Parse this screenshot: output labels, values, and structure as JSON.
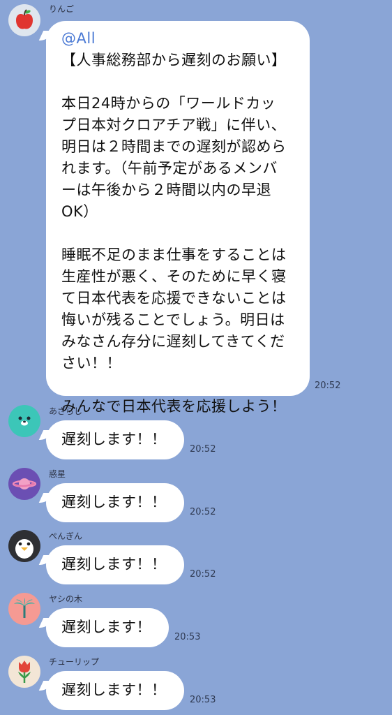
{
  "messages": [
    {
      "sender": "りんご",
      "avatar_icon": "apple-icon",
      "mention": "@All",
      "lines": [
        "【人事総務部から遅刻のお願い】",
        "",
        "本日24時からの「ワールドカッ",
        "プ日本対クロアチア戦」に伴い、",
        "明日は２時間までの遅刻が認めら",
        "れます。（午前予定があるメンバ",
        "ーは午後から２時間以内の早退",
        "OK）",
        "",
        "睡眠不足のまま仕事をすることは",
        "生産性が悪く、そのために早く寝",
        "て日本代表を応援できないことは",
        "悔いが残ることでしょう。明日は",
        "みなさん存分に遅刻してきてくだ",
        "さい！！",
        "",
        "みんなで日本代表を応援しよう！"
      ],
      "time": "20:52"
    },
    {
      "sender": "あざらし",
      "avatar_icon": "seal-icon",
      "text": "遅刻します！！",
      "time": "20:52"
    },
    {
      "sender": "惑星",
      "avatar_icon": "planet-icon",
      "text": "遅刻します！！",
      "time": "20:52"
    },
    {
      "sender": "ぺんぎん",
      "avatar_icon": "penguin-icon",
      "text": "遅刻します！！",
      "time": "20:52"
    },
    {
      "sender": "ヤシの木",
      "avatar_icon": "palm-tree-icon",
      "text": "遅刻します！",
      "time": "20:53"
    },
    {
      "sender": "チューリップ",
      "avatar_icon": "tulip-icon",
      "text": "遅刻します！！",
      "time": "20:53"
    }
  ],
  "colors": {
    "background": "#8aa5d6",
    "bubble": "#ffffff",
    "mention": "#4a79d4"
  }
}
